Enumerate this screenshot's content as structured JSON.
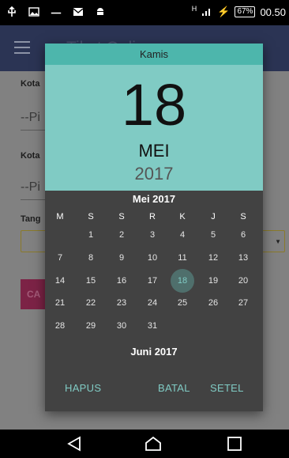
{
  "status_bar": {
    "icons_left": [
      "usb-icon",
      "image-icon",
      "asus-icon",
      "mail-icon",
      "android-icon"
    ],
    "signal_label": "H",
    "battery": "67%",
    "time": "00.50"
  },
  "background": {
    "app_title": "Tiket Online",
    "label_1": "Kota",
    "pick_1": "--Pi",
    "label_2": "Kota",
    "pick_2": "--Pi",
    "label_3": "Tang",
    "button_label": "CA"
  },
  "dialog": {
    "day_of_week": "Kamis",
    "day": "18",
    "month": "MEI",
    "year": "2017",
    "calendar_title": "Mei 2017",
    "weekday_headers": [
      "M",
      "S",
      "S",
      "R",
      "K",
      "J",
      "S"
    ],
    "weeks": [
      [
        "",
        "1",
        "2",
        "3",
        "4",
        "5",
        "6"
      ],
      [
        "7",
        "8",
        "9",
        "10",
        "11",
        "12",
        "13"
      ],
      [
        "14",
        "15",
        "16",
        "17",
        "18",
        "19",
        "20"
      ],
      [
        "21",
        "22",
        "23",
        "24",
        "25",
        "26",
        "27"
      ],
      [
        "28",
        "29",
        "30",
        "31",
        "",
        "",
        ""
      ]
    ],
    "selected_day": "18",
    "next_month_title": "Juni 2017",
    "actions": {
      "clear": "HAPUS",
      "cancel": "BATAL",
      "set": "SETEL"
    }
  },
  "colors": {
    "header_light": "#80cbc4",
    "header_dark": "#4db6ac",
    "dialog_body": "#424242",
    "accent": "#80cbc4"
  }
}
